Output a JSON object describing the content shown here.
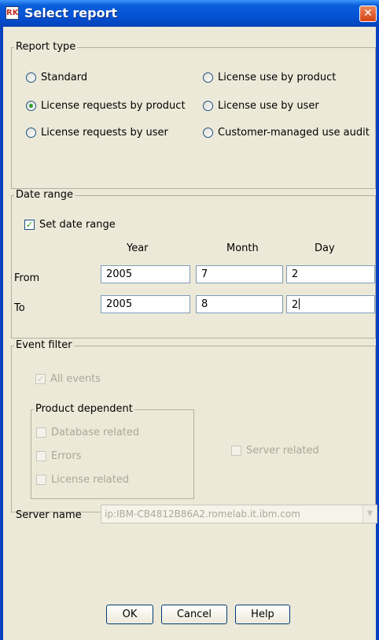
{
  "window": {
    "title": "Select report",
    "icon_label": "RK"
  },
  "report_type": {
    "legend": "Report type",
    "options": [
      {
        "label": "Standard",
        "selected": false
      },
      {
        "label": "License requests by product",
        "selected": true
      },
      {
        "label": "License requests by user",
        "selected": false
      },
      {
        "label": "License use by product",
        "selected": false
      },
      {
        "label": "License use by user",
        "selected": false
      },
      {
        "label": "Customer-managed use audit",
        "selected": false
      }
    ]
  },
  "date_range": {
    "legend": "Date range",
    "set_date_range_label": "Set date range",
    "set_date_range_checked": true,
    "col_year": "Year",
    "col_month": "Month",
    "col_day": "Day",
    "from_label": "From",
    "to_label": "To",
    "from": {
      "year": "2005",
      "month": "7",
      "day": "2"
    },
    "to": {
      "year": "2005",
      "month": "8",
      "day": "2"
    }
  },
  "event_filter": {
    "legend": "Event filter",
    "all_events": "All events",
    "all_events_checked": true,
    "product_dependent": {
      "legend": "Product dependent",
      "database_related": "Database related",
      "errors": "Errors",
      "license_related": "License related"
    },
    "server_related": "Server related"
  },
  "server": {
    "label": "Server name",
    "value": "ip:IBM-CB4812B86A2.romelab.it.ibm.com"
  },
  "buttons": {
    "ok": "OK",
    "cancel": "Cancel",
    "help": "Help"
  }
}
